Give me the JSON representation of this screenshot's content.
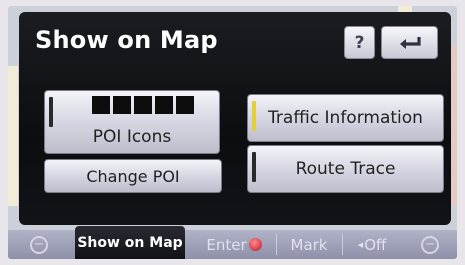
{
  "dialog": {
    "title": "Show on Map",
    "help_label": "?",
    "back_icon": "return-arrow-icon"
  },
  "options": {
    "poi_icons": {
      "label": "POI Icons",
      "slots": 5,
      "active": false
    },
    "traffic_information": {
      "label": "Traffic Information",
      "active": true
    },
    "change_poi": {
      "label": "Change POI"
    },
    "route_trace": {
      "label": "Route Trace",
      "active": false
    }
  },
  "tabbar": {
    "zoom_out_icon": "zoom-out-icon",
    "active_tab": "Show on Map",
    "enter": "Enter",
    "mark": "Mark",
    "off": "Off",
    "zoom_in_icon": "zoom-in-icon"
  },
  "colors": {
    "dialog_bg": "#0c0d10",
    "button_bg": "#d4d3e0",
    "indicator_on": "#e2cf3a",
    "indicator_off": "#2a2a2a",
    "tabbar_bg": "#9ea1b8"
  }
}
